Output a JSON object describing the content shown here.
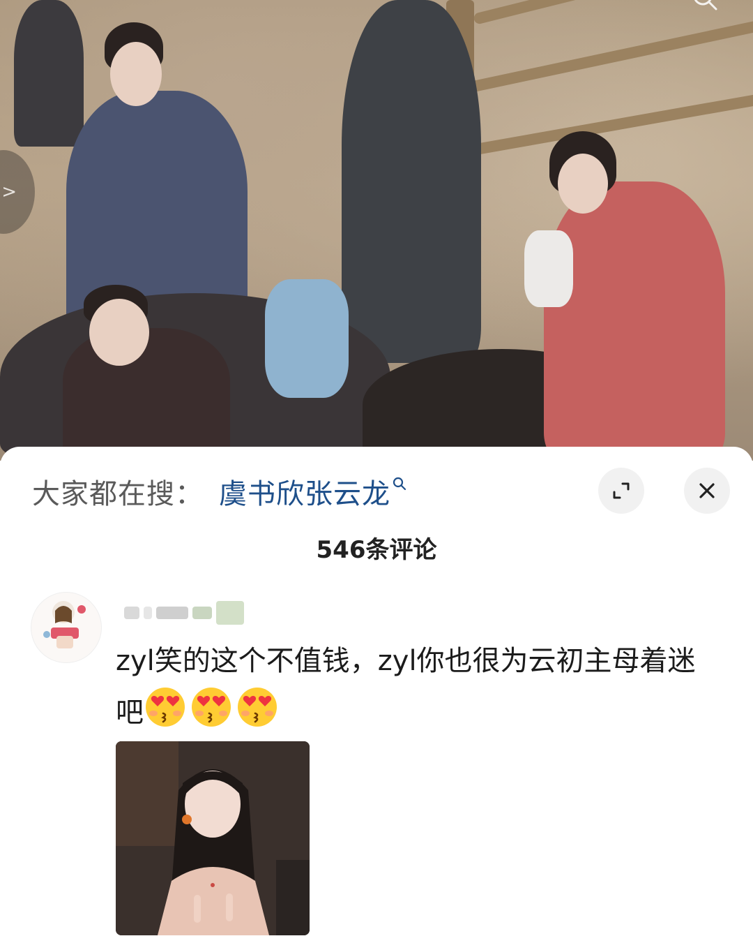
{
  "video": {
    "side_button_glyph": ">",
    "top_icon": "search-icon"
  },
  "panel": {
    "search_prefix": "大家都在搜：",
    "search_term": "虞书欣张云龙",
    "search_term_icon": "search-icon",
    "expand_icon": "expand-icon",
    "close_icon": "close-icon",
    "comment_count": "546条评论"
  },
  "comment": {
    "text": "zyl笑的这个不值钱，zyl你也很为云初主母着迷吧",
    "emoji": [
      "heart-eyes-kiss-emoji",
      "heart-eyes-kiss-emoji",
      "heart-eyes-kiss-emoji"
    ]
  },
  "colors": {
    "search_term": "#1e4f8a",
    "panel_bg": "#ffffff",
    "button_bg": "#f1f1f1"
  }
}
